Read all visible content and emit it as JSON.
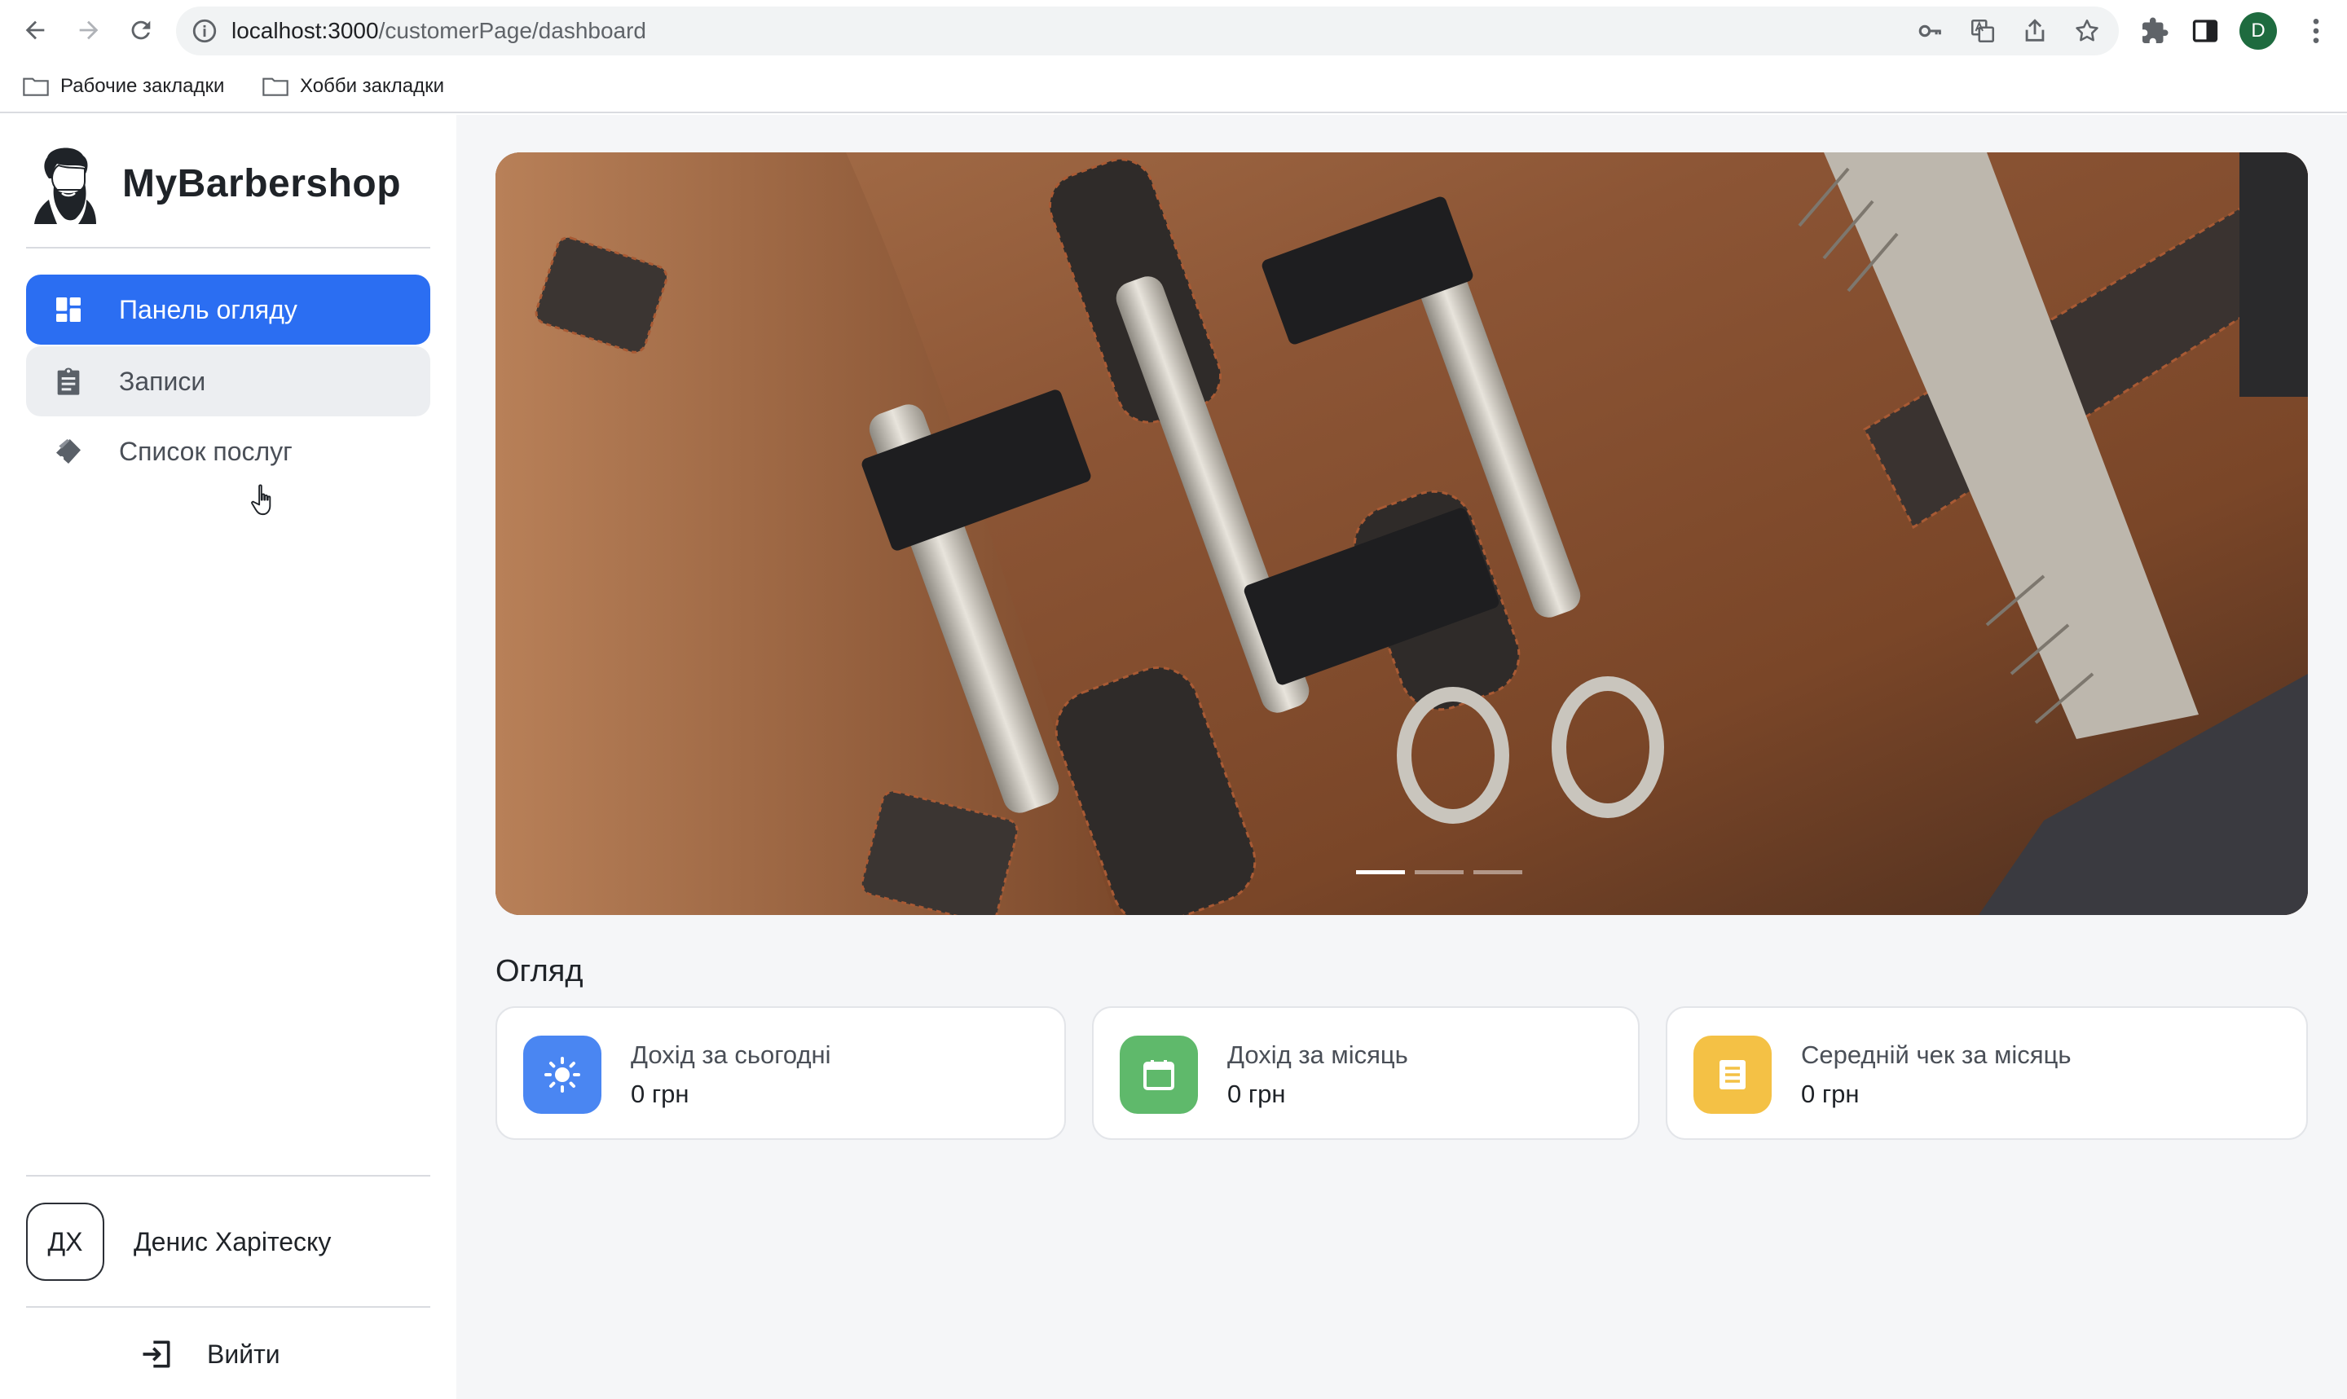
{
  "browser": {
    "url_host": "localhost:3000",
    "url_path": "/customerPage/dashboard",
    "profile_initial": "D",
    "bookmarks": [
      {
        "label": "Рабочие закладки"
      },
      {
        "label": "Хобби закладки"
      }
    ]
  },
  "sidebar": {
    "brand_name": "MyBarbershop",
    "items": [
      {
        "label": "Панель огляду",
        "icon": "dashboard-icon",
        "state": "active"
      },
      {
        "label": "Записи",
        "icon": "clipboard-icon",
        "state": "hover"
      },
      {
        "label": "Список послуг",
        "icon": "tag-icon",
        "state": "normal"
      }
    ],
    "user": {
      "initials": "ДХ",
      "name": "Денис Харітеску"
    },
    "logout_label": "Вийти"
  },
  "main": {
    "hero": {
      "image": "barber-tools-leather-roll",
      "slides": 3,
      "active_slide": 1
    },
    "overview_title": "Огляд",
    "cards": [
      {
        "label": "Дохід за сьогодні",
        "value": "0 грн",
        "icon": "sun-icon",
        "color": "#4a86f2"
      },
      {
        "label": "Дохід за місяць",
        "value": "0 грн",
        "icon": "calendar-icon",
        "color": "#5fb96b"
      },
      {
        "label": "Середній чек за місяць",
        "value": "0 грн",
        "icon": "receipt-icon",
        "color": "#f4c145"
      }
    ]
  },
  "colors": {
    "accent": "#2b6ef2",
    "main_bg": "#f5f6f8"
  }
}
